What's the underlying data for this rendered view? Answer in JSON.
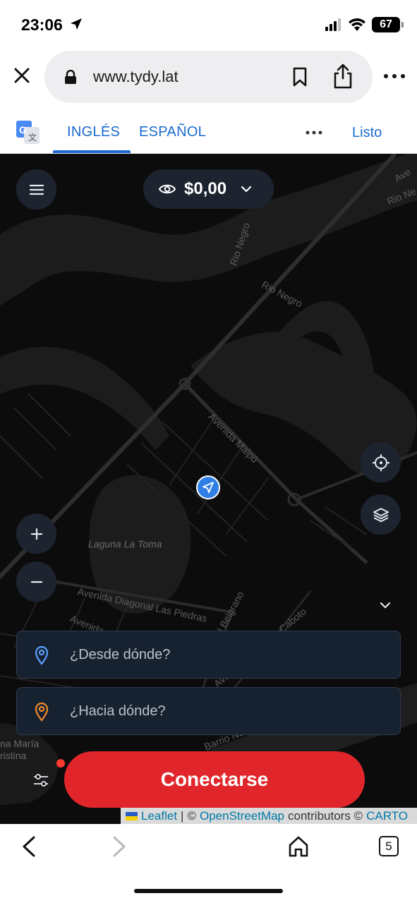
{
  "status_bar": {
    "time": "23:06",
    "battery": "67"
  },
  "browser": {
    "url": "www.tydy.lat"
  },
  "translate_bar": {
    "tabs": [
      "INGLÉS",
      "ESPAÑOL"
    ],
    "done_label": "Listo"
  },
  "app": {
    "balance": "$0,00",
    "from_placeholder": "¿Desde dónde?",
    "to_placeholder": "¿Hacia dónde?",
    "connect_label": "Conectarse"
  },
  "map": {
    "labels": {
      "rio_negro_1": "Rio Negro",
      "rio_negro_2": "Rio Negro",
      "rio_ne": "Rio Ne",
      "ave": "Ave",
      "avenida_maipu": "Avenida Maipú",
      "laguna": "Laguna La Toma",
      "diagonal": "Avenida Diagonal Las Piedras",
      "avenida_left": "Avenida",
      "belgrano": "General Belgrano",
      "caboto": "Avenida Sebastián Caboto",
      "barrio": "Barrio Nuevo",
      "cristina_1": "na María",
      "cristina_2": "ristina"
    }
  },
  "attribution": {
    "leaflet": "Leaflet",
    "sep": "|",
    "copyright_1": "©",
    "osm": "OpenStreetMap",
    "contributors": "contributors ©",
    "carto": "CARTO"
  },
  "bottom_bar": {
    "tab_count": "5"
  }
}
